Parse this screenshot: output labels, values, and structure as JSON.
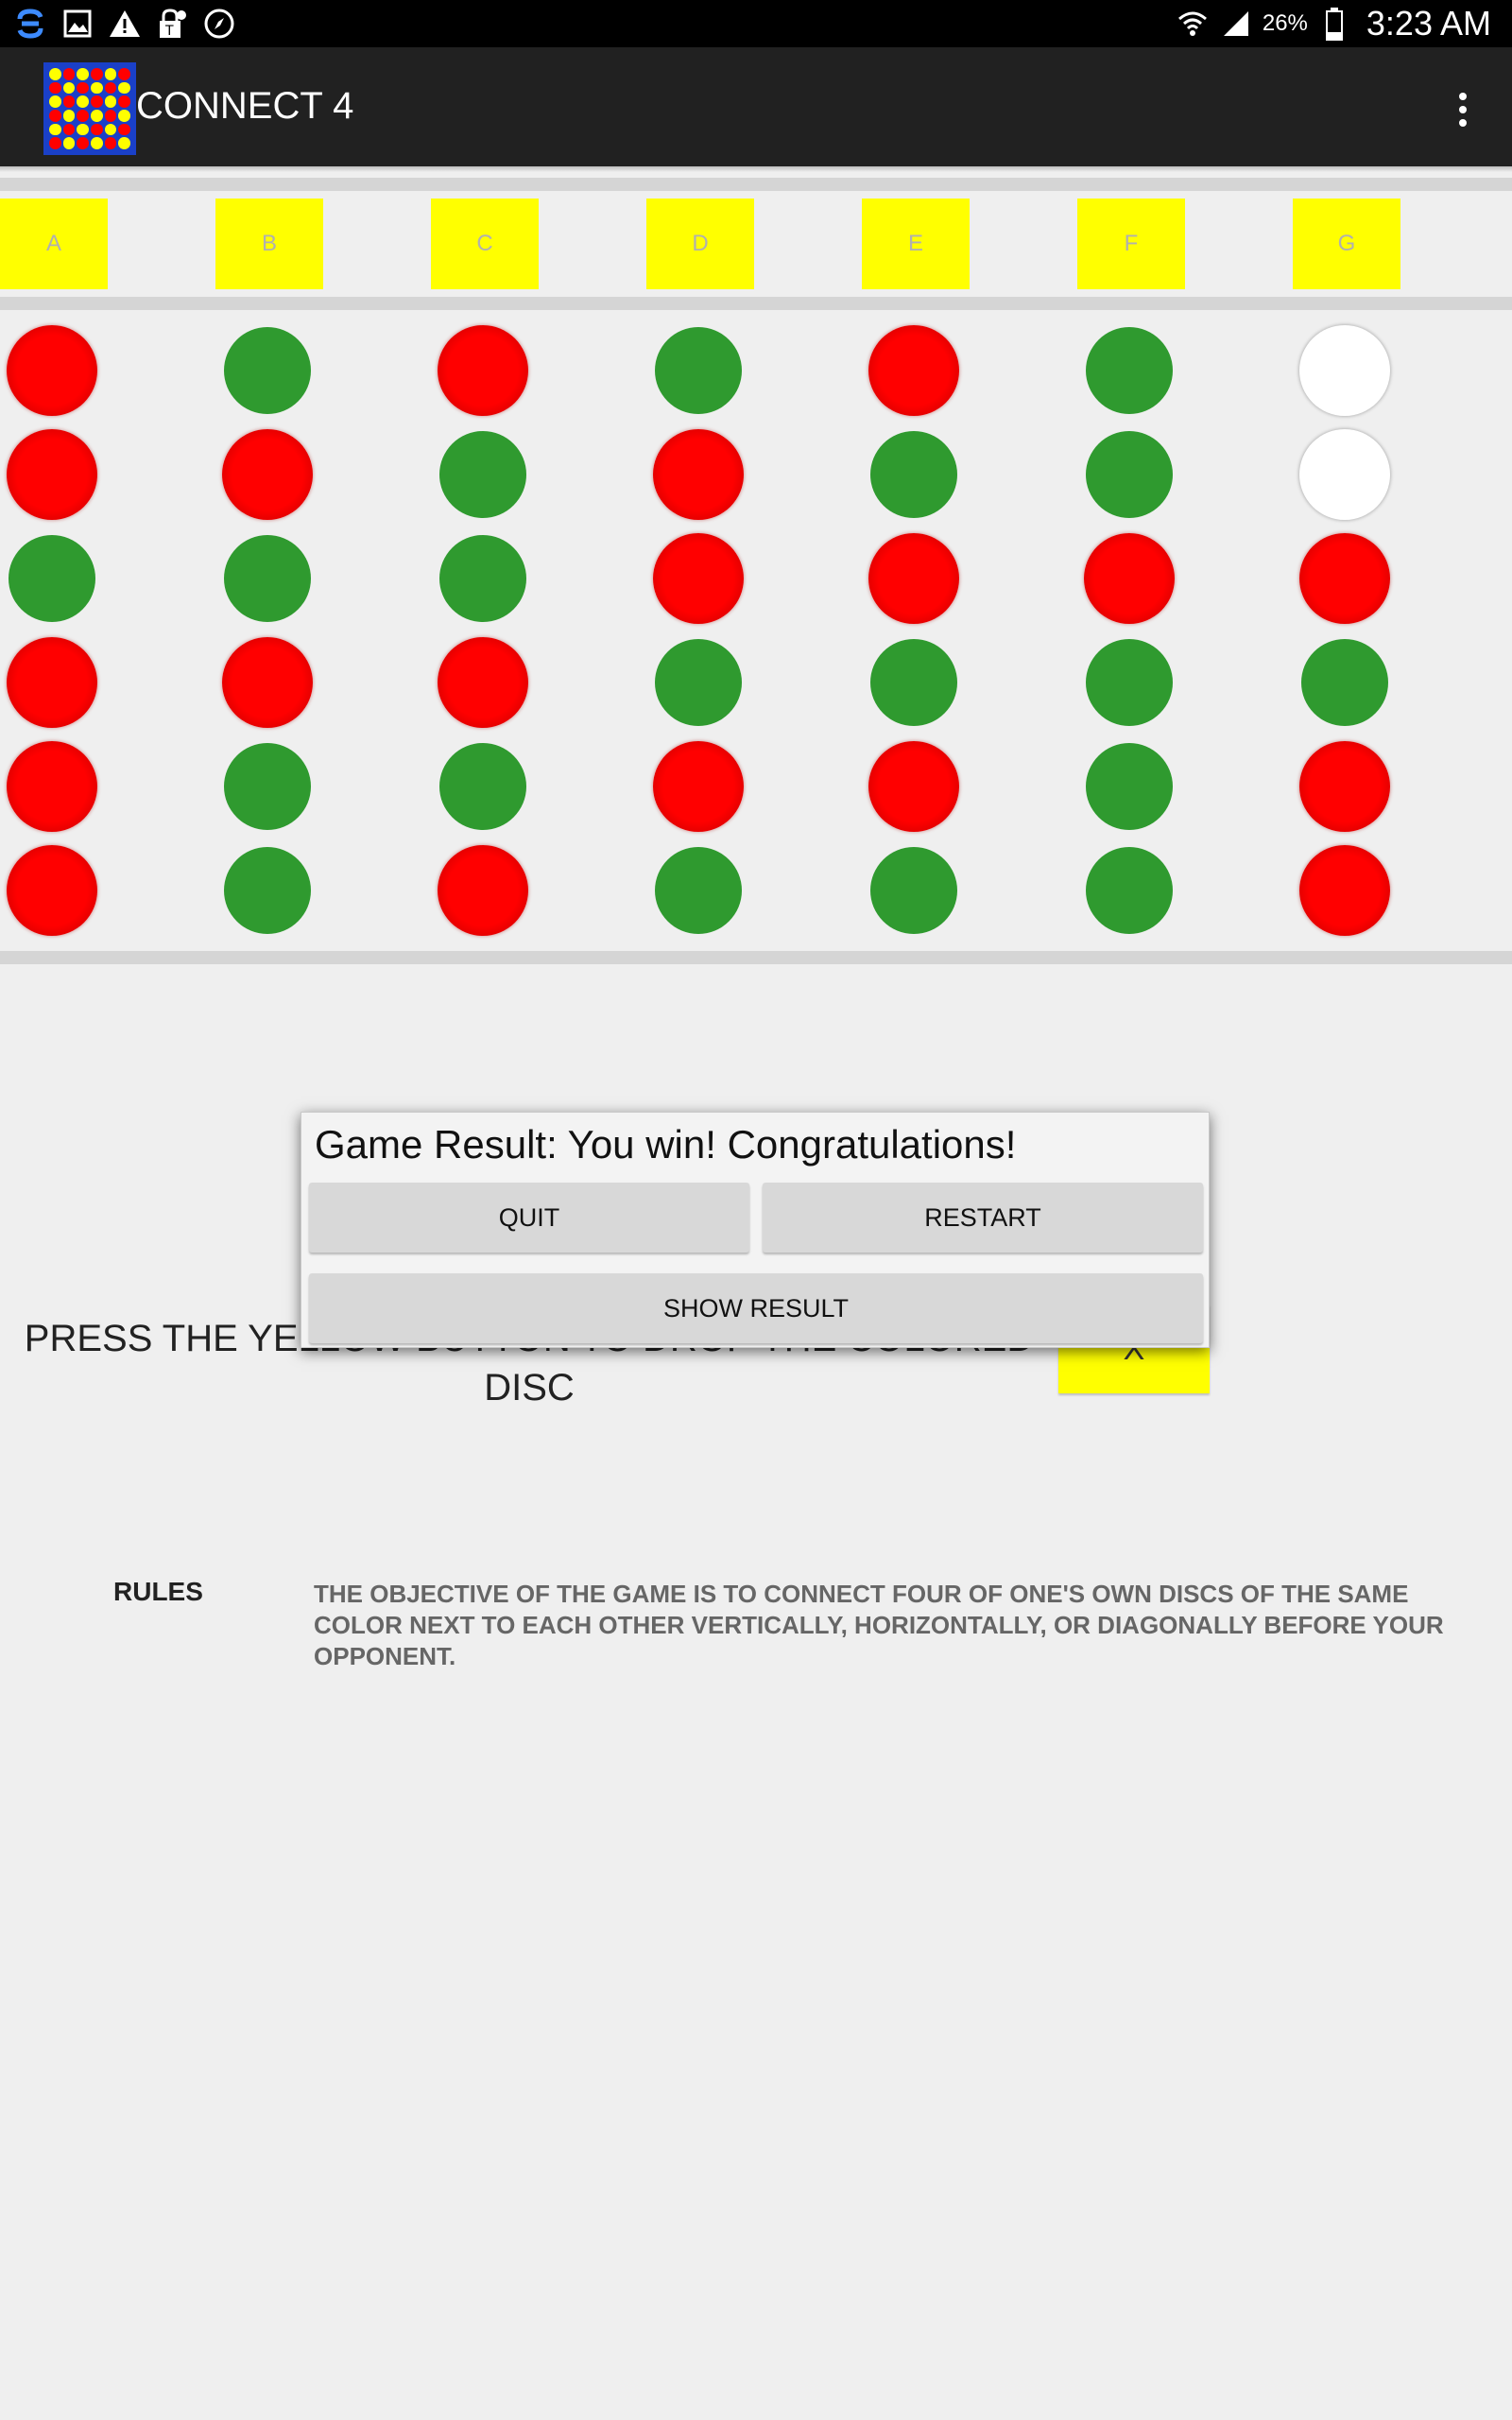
{
  "status_bar": {
    "left_icons": [
      "sync-icon",
      "image-icon",
      "warning-icon",
      "tmobile-lock-icon",
      "compass-icon"
    ],
    "battery_percent": "26%",
    "time": "3:23 AM"
  },
  "app_bar": {
    "title": "CONNECT 4",
    "menu_icon": "overflow-menu-icon"
  },
  "columns": [
    "A",
    "B",
    "C",
    "D",
    "E",
    "F",
    "G"
  ],
  "board": {
    "colors": {
      "red": "#ff0000",
      "green": "#2f9a2f",
      "white": "#ffffff",
      "yellow": "#ffff00"
    },
    "rows": [
      [
        "red",
        "green",
        "red",
        "green",
        "red",
        "green",
        "white"
      ],
      [
        "red",
        "red",
        "green",
        "red",
        "green",
        "green",
        "white"
      ],
      [
        "green",
        "green",
        "green",
        "red",
        "red",
        "red",
        "red"
      ],
      [
        "red",
        "red",
        "red",
        "green",
        "green",
        "green",
        "green"
      ],
      [
        "red",
        "green",
        "green",
        "red",
        "red",
        "green",
        "red"
      ],
      [
        "red",
        "green",
        "red",
        "green",
        "green",
        "green",
        "red"
      ]
    ]
  },
  "instructions": {
    "text": "PRESS THE YELLOW BUTTON TO DROP THE COLORED DISC",
    "button_label": "X"
  },
  "rules": {
    "heading": "RULES",
    "text": "THE OBJECTIVE OF THE GAME IS TO CONNECT FOUR OF ONE'S OWN DISCS OF THE SAME COLOR NEXT TO EACH OTHER VERTICALLY, HORIZONTALLY, OR DIAGONALLY BEFORE YOUR OPPONENT."
  },
  "dialog": {
    "message": "Game Result: You win! Congratulations!",
    "quit_label": "QUIT",
    "restart_label": "RESTART",
    "show_result_label": "SHOW RESULT"
  }
}
